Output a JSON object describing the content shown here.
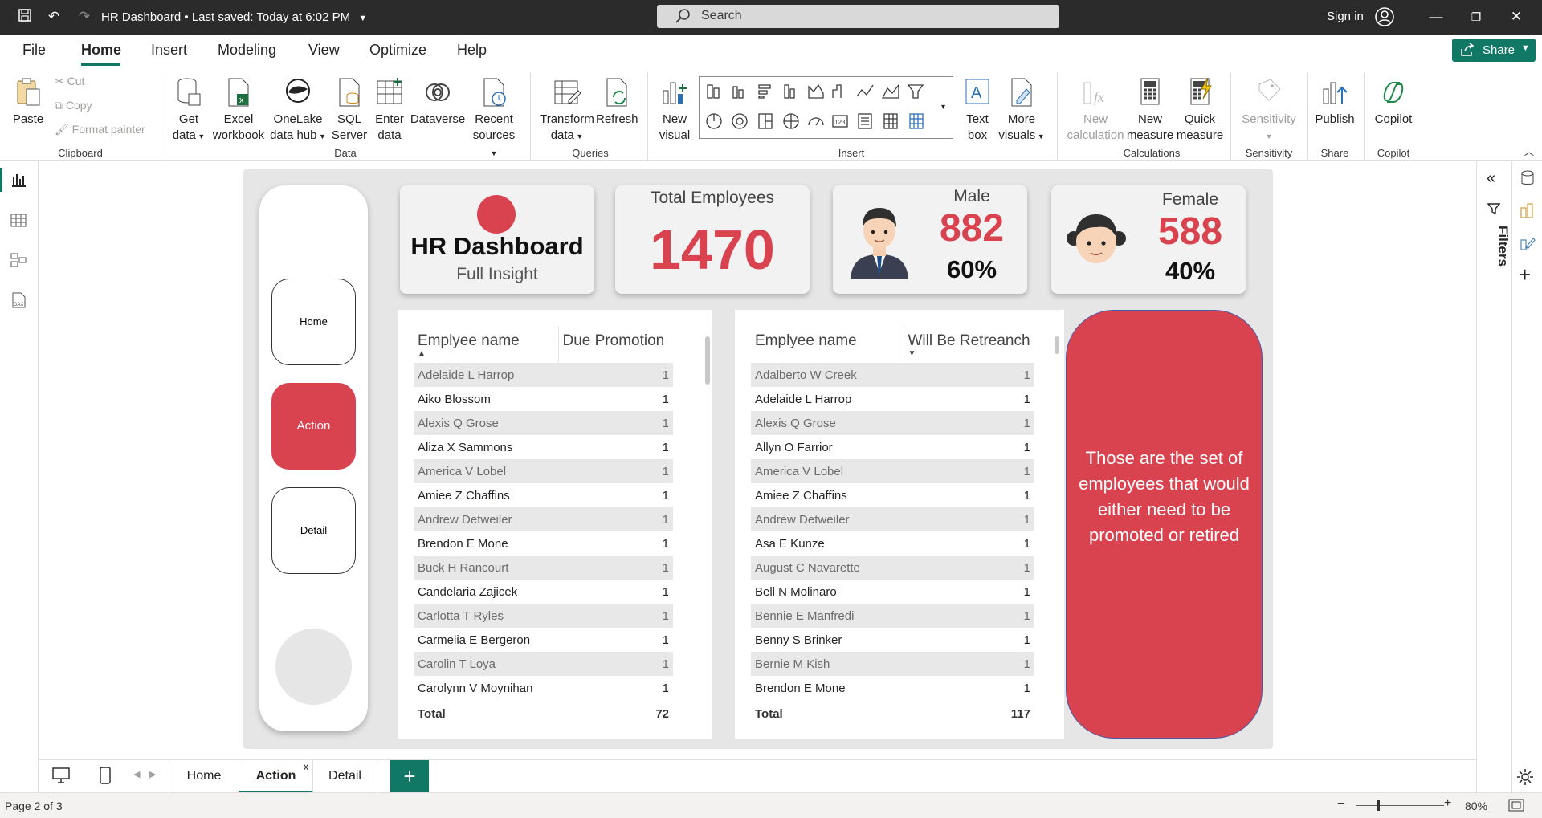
{
  "titlebar": {
    "title": "HR Dashboard",
    "saved": "Last saved: Today at 6:02 PM",
    "search_placeholder": "Search",
    "signin": "Sign in"
  },
  "menu": [
    "File",
    "Home",
    "Insert",
    "Modeling",
    "View",
    "Optimize",
    "Help"
  ],
  "share_label": "Share",
  "ribbon": {
    "paste": "Paste",
    "cut": "Cut",
    "copy": "Copy",
    "format_painter": "Format painter",
    "get_data": [
      "Get",
      "data"
    ],
    "excel": [
      "Excel",
      "workbook"
    ],
    "onelake": [
      "OneLake",
      "data hub"
    ],
    "sql": [
      "SQL",
      "Server"
    ],
    "enter": [
      "Enter",
      "data"
    ],
    "dataverse": "Dataverse",
    "recent": [
      "Recent",
      "sources"
    ],
    "transform": [
      "Transform",
      "data"
    ],
    "refresh": "Refresh",
    "new_visual": [
      "New",
      "visual"
    ],
    "text_box": [
      "Text",
      "box"
    ],
    "more_visuals": [
      "More",
      "visuals"
    ],
    "new_calc": [
      "New",
      "calculation"
    ],
    "new_measure": [
      "New",
      "measure"
    ],
    "quick_measure": [
      "Quick",
      "measure"
    ],
    "sensitivity": "Sensitivity",
    "publish": "Publish",
    "copilot": "Copilot",
    "groups": [
      "Clipboard",
      "Data",
      "Queries",
      "Insert",
      "Calculations",
      "Sensitivity",
      "Share",
      "Copilot"
    ]
  },
  "nav": {
    "home": "Home",
    "action": "Action",
    "detail": "Detail"
  },
  "cards": {
    "title": "HR Dashboard",
    "subtitle": "Full Insight",
    "total_label": "Total Employees",
    "total_value": "1470",
    "male_label": "Male",
    "male_value": "882",
    "male_pct": "60%",
    "female_label": "Female",
    "female_value": "588",
    "female_pct": "40%"
  },
  "table1": {
    "headers": [
      "Emplyee name",
      "Due Promotion"
    ],
    "rows": [
      [
        "Adelaide L Harrop",
        "1"
      ],
      [
        "Aiko Blossom",
        "1"
      ],
      [
        "Alexis Q Grose",
        "1"
      ],
      [
        "Aliza X Sammons",
        "1"
      ],
      [
        "America V Lobel",
        "1"
      ],
      [
        "Amiee Z Chaffins",
        "1"
      ],
      [
        "Andrew Detweiler",
        "1"
      ],
      [
        "Brendon E Mone",
        "1"
      ],
      [
        "Buck H Rancourt",
        "1"
      ],
      [
        "Candelaria Zajicek",
        "1"
      ],
      [
        "Carlotta T Ryles",
        "1"
      ],
      [
        "Carmelia E Bergeron",
        "1"
      ],
      [
        "Carolin T Loya",
        "1"
      ],
      [
        "Carolynn V Moynihan",
        "1"
      ]
    ],
    "total_label": "Total",
    "total_value": "72"
  },
  "table2": {
    "headers": [
      "Emplyee name",
      "Will Be Retreanch"
    ],
    "rows": [
      [
        "Adalberto W Creek",
        "1"
      ],
      [
        "Adelaide L Harrop",
        "1"
      ],
      [
        "Alexis Q Grose",
        "1"
      ],
      [
        "Allyn O Farrior",
        "1"
      ],
      [
        "America V Lobel",
        "1"
      ],
      [
        "Amiee Z Chaffins",
        "1"
      ],
      [
        "Andrew Detweiler",
        "1"
      ],
      [
        "Asa E Kunze",
        "1"
      ],
      [
        "August C Navarette",
        "1"
      ],
      [
        "Bell N Molinaro",
        "1"
      ],
      [
        "Bennie E Manfredi",
        "1"
      ],
      [
        "Benny S Brinker",
        "1"
      ],
      [
        "Bernie M Kish",
        "1"
      ],
      [
        "Brendon E Mone",
        "1"
      ]
    ],
    "total_label": "Total",
    "total_value": "117"
  },
  "note": "Those are the set of employees that would either need to be promoted or retired",
  "filters_label": "Filters",
  "pages": [
    "Home",
    "Action",
    "Detail"
  ],
  "status": {
    "page": "Page 2 of 3",
    "zoom": "80%"
  },
  "colors": {
    "accent": "#117865",
    "red": "#d9434f",
    "dark": "#2b2b2b"
  }
}
